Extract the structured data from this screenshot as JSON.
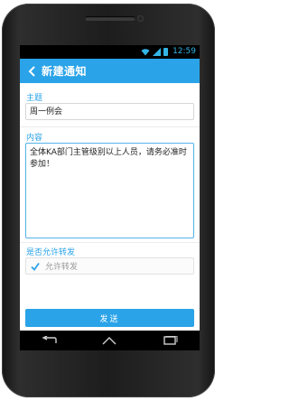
{
  "status_bar": {
    "time": "12:59"
  },
  "action_bar": {
    "title": "新建通知",
    "back_icon": "back-arrow-icon"
  },
  "form": {
    "subject": {
      "label": "主题",
      "value": "周一例会"
    },
    "content": {
      "label": "内容",
      "value": "全体KA部门主管级别以上人员，请务必准时参加！"
    },
    "allow_forward": {
      "label": "是否允许转发",
      "option_label": "允许转发",
      "checked": true
    }
  },
  "send_button": {
    "label": "发送"
  },
  "colors": {
    "accent": "#2aa3e8",
    "status_icons": "#33b5e5"
  }
}
